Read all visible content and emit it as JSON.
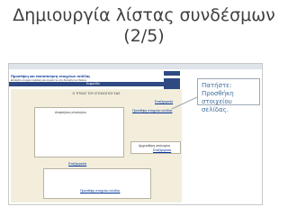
{
  "slide": {
    "title_line1": "Δημιουργία λίστας συνδέσμων",
    "title_line2": "(2/5)"
  },
  "callout": {
    "line1": "Πατήστε: Προσθήκη",
    "line2": "στοιχείου σελίδας."
  },
  "screenshot": {
    "header_title": "Προσθήκη και τακτοποίηση στοιχείων σελίδας",
    "header_description": "Επιλέξτε στοιχεία σελίδας και σύρετέ τα στη διάταξη που θέλετε.",
    "nav_label": "Κεφαλίδα",
    "banner_text": "Ο ΤΙΤΛΟΣ ΤΟΥ ΙΣΤΟΛΟΓΙΟΥ ΣΑΣ",
    "edit_label": "Επεξεργασία",
    "add_element_label": "Προσθήκη στοιχείου σελίδας",
    "posts_label": "Αναρτήσεις ιστολογίου",
    "archive_label": "Αρχειοθήκη ιστολογίου",
    "colors": {
      "nav": "#2f4a83",
      "content_bg": "#f3eedc",
      "link": "#003399"
    }
  }
}
